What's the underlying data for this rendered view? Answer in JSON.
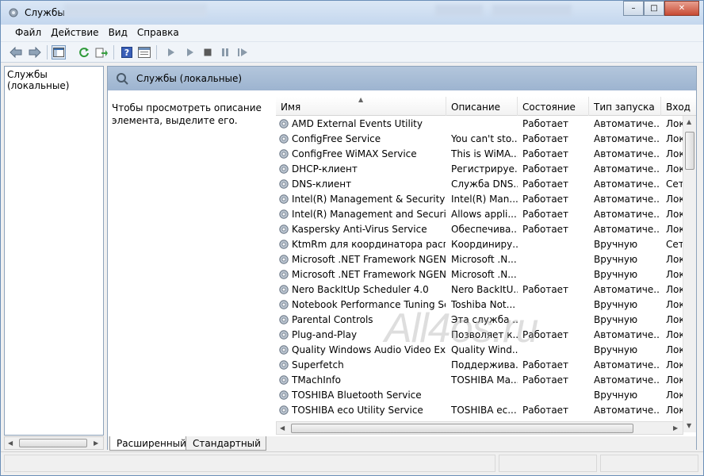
{
  "window": {
    "title": "Службы",
    "close_label": "✕",
    "minimize_label": "–",
    "maximize_label": "□"
  },
  "menu": [
    "Файл",
    "Действие",
    "Вид",
    "Справка"
  ],
  "tree": {
    "root": "Службы (локальные)"
  },
  "banner": {
    "title": "Службы (локальные)"
  },
  "description": "Чтобы просмотреть описание элемента, выделите его.",
  "columns": [
    "Имя",
    "Описание",
    "Состояние",
    "Тип запуска",
    "Вход"
  ],
  "rows": [
    {
      "name": "AMD External Events Utility",
      "desc": "",
      "state": "Работает",
      "start": "Автоматиче...",
      "login": "Лок"
    },
    {
      "name": "ConfigFree Service",
      "desc": "You can't sto...",
      "state": "Работает",
      "start": "Автоматиче...",
      "login": "Лок"
    },
    {
      "name": "ConfigFree WiMAX Service",
      "desc": "This is WiMA...",
      "state": "Работает",
      "start": "Автоматиче...",
      "login": "Лок"
    },
    {
      "name": "DHCP-клиент",
      "desc": "Регистрируе...",
      "state": "Работает",
      "start": "Автоматиче...",
      "login": "Лок"
    },
    {
      "name": "DNS-клиент",
      "desc": "Служба DNS...",
      "state": "Работает",
      "start": "Автоматиче...",
      "login": "Сет"
    },
    {
      "name": "Intel(R) Management & Security A...",
      "desc": "Intel(R) Man...",
      "state": "Работает",
      "start": "Автоматиче...",
      "login": "Лок"
    },
    {
      "name": "Intel(R) Management and Security ...",
      "desc": "Allows appli...",
      "state": "Работает",
      "start": "Автоматиче...",
      "login": "Лок"
    },
    {
      "name": "Kaspersky Anti-Virus Service",
      "desc": "Обеспечива...",
      "state": "Работает",
      "start": "Автоматиче...",
      "login": "Лок"
    },
    {
      "name": "KtmRm для координатора распр...",
      "desc": "Координиру...",
      "state": "",
      "start": "Вручную",
      "login": "Сет"
    },
    {
      "name": "Microsoft .NET Framework NGEN ...",
      "desc": "Microsoft .N...",
      "state": "",
      "start": "Вручную",
      "login": "Лок"
    },
    {
      "name": "Microsoft .NET Framework NGEN ...",
      "desc": "Microsoft .N...",
      "state": "",
      "start": "Вручную",
      "login": "Лок"
    },
    {
      "name": "Nero BackItUp Scheduler 4.0",
      "desc": "Nero BackItU...",
      "state": "Работает",
      "start": "Автоматиче...",
      "login": "Лок"
    },
    {
      "name": "Notebook Performance Tuning Se...",
      "desc": "Toshiba Not...",
      "state": "",
      "start": "Вручную",
      "login": "Лок"
    },
    {
      "name": "Parental Controls",
      "desc": "Эта служба ...",
      "state": "",
      "start": "Вручную",
      "login": "Лок"
    },
    {
      "name": "Plug-and-Play",
      "desc": "Позволяет к...",
      "state": "Работает",
      "start": "Автоматиче...",
      "login": "Лок"
    },
    {
      "name": "Quality Windows Audio Video Exp...",
      "desc": "Quality Wind...",
      "state": "",
      "start": "Вручную",
      "login": "Лок"
    },
    {
      "name": "Superfetch",
      "desc": "Поддержива...",
      "state": "Работает",
      "start": "Автоматиче...",
      "login": "Лок"
    },
    {
      "name": "TMachInfo",
      "desc": "TOSHIBA Ma...",
      "state": "Работает",
      "start": "Автоматиче...",
      "login": "Лок"
    },
    {
      "name": "TOSHIBA Bluetooth Service",
      "desc": "",
      "state": "",
      "start": "Вручную",
      "login": "Лок"
    },
    {
      "name": "TOSHIBA eco Utility Service",
      "desc": "TOSHIBA ec...",
      "state": "Работает",
      "start": "Автоматиче...",
      "login": "Лок"
    }
  ],
  "tabs": [
    "Расширенный",
    "Стандартный"
  ],
  "watermark": "All4os.ru",
  "colors": {
    "banner": "#a7bdd6",
    "titlebar": "#c4d7ee",
    "watermark": "#a0a0a0"
  }
}
